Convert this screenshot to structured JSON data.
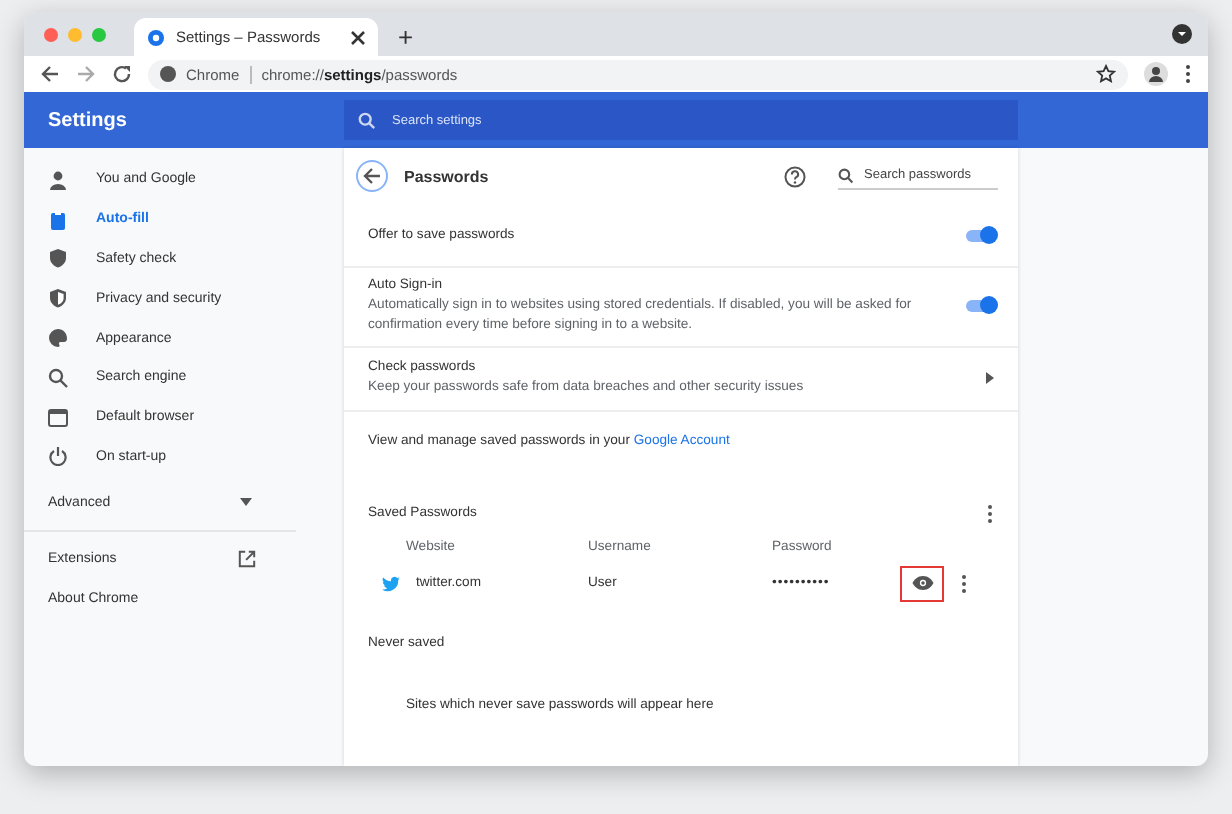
{
  "browser": {
    "tab_title": "Settings – Passwords",
    "new_tab": "+",
    "omnibox_label": "Chrome",
    "url_prefix": "chrome://",
    "url_bold": "settings",
    "url_suffix": "/passwords"
  },
  "header": {
    "title": "Settings",
    "search_placeholder": "Search settings"
  },
  "sidebar": {
    "items": [
      {
        "label": "You and Google",
        "selected": false
      },
      {
        "label": "Auto-fill",
        "selected": true
      },
      {
        "label": "Safety check",
        "selected": false
      },
      {
        "label": "Privacy and security",
        "selected": false
      },
      {
        "label": "Appearance",
        "selected": false
      },
      {
        "label": "Search engine",
        "selected": false
      },
      {
        "label": "Default browser",
        "selected": false
      },
      {
        "label": "On start-up",
        "selected": false
      }
    ],
    "advanced": {
      "label": "Advanced",
      "expanded": false
    },
    "links": [
      {
        "label": "Extensions",
        "external": true
      },
      {
        "label": "About Chrome",
        "external": false
      }
    ]
  },
  "page": {
    "title": "Passwords",
    "search_placeholder": "Search passwords",
    "settings": [
      {
        "kind": "toggle",
        "title": "Offer to save passwords",
        "on": true
      },
      {
        "kind": "toggle",
        "title": "Auto Sign-in",
        "description": "Automatically sign in to websites using stored credentials. If disabled, you will be asked for confirmation every time before signing in to a website.",
        "on": true
      },
      {
        "kind": "link",
        "title": "Check passwords",
        "description": "Keep your passwords safe from data breaches and other security issues"
      }
    ],
    "manage_text": "View and manage saved passwords in your ",
    "manage_link": "Google Account",
    "saved": {
      "title": "Saved Passwords",
      "columns": [
        "Website",
        "Username",
        "Password"
      ],
      "rows": [
        {
          "website": "twitter.com",
          "username": "User",
          "password": "••••••••••",
          "reveal_highlighted": true
        }
      ]
    },
    "never_saved": {
      "title": "Never saved",
      "empty_text": "Sites which never save passwords will appear here"
    }
  }
}
